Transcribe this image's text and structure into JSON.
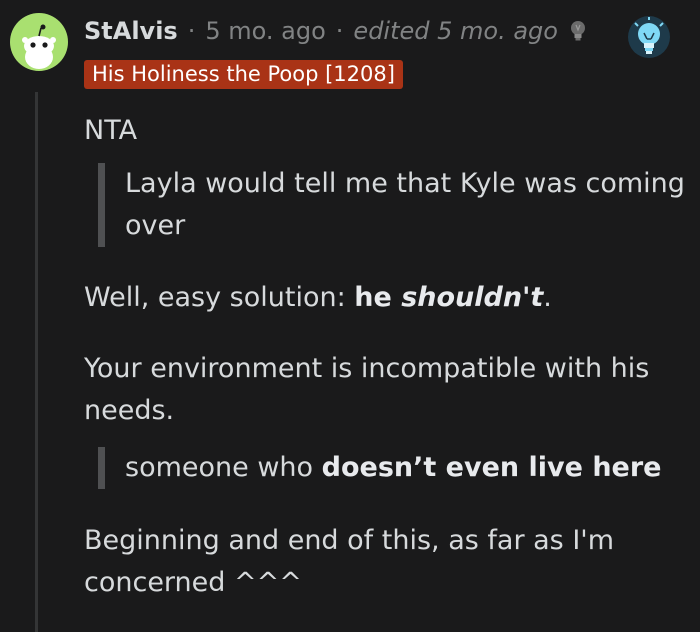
{
  "comment": {
    "username": "StAlvis",
    "time_ago": "5 mo. ago",
    "edited": "edited 5 mo. ago",
    "separator": "·",
    "flair": "His Holiness the Poop [1208]",
    "icons": {
      "avatar": "snoo-avatar-icon",
      "award": "bulb-award-icon",
      "badge": "lightbulb-badge-icon"
    },
    "colors": {
      "flair_bg": "#a93316",
      "avatar_bg": "#a9e070",
      "background": "#1a1a1b"
    },
    "body": {
      "p1": "NTA",
      "quote1": "Layla would tell me that Kyle was coming over",
      "p2_prefix": "Well, easy solution: ",
      "p2_bold": "he ",
      "p2_bold_italic": "shouldn't",
      "p2_suffix": ".",
      "p3": "Your environment is incompatible with his needs.",
      "quote2_prefix": "someone who ",
      "quote2_bold": "doesn’t even live here",
      "p4": "Beginning and end of this, as far as I'm concerned ^^^"
    }
  }
}
